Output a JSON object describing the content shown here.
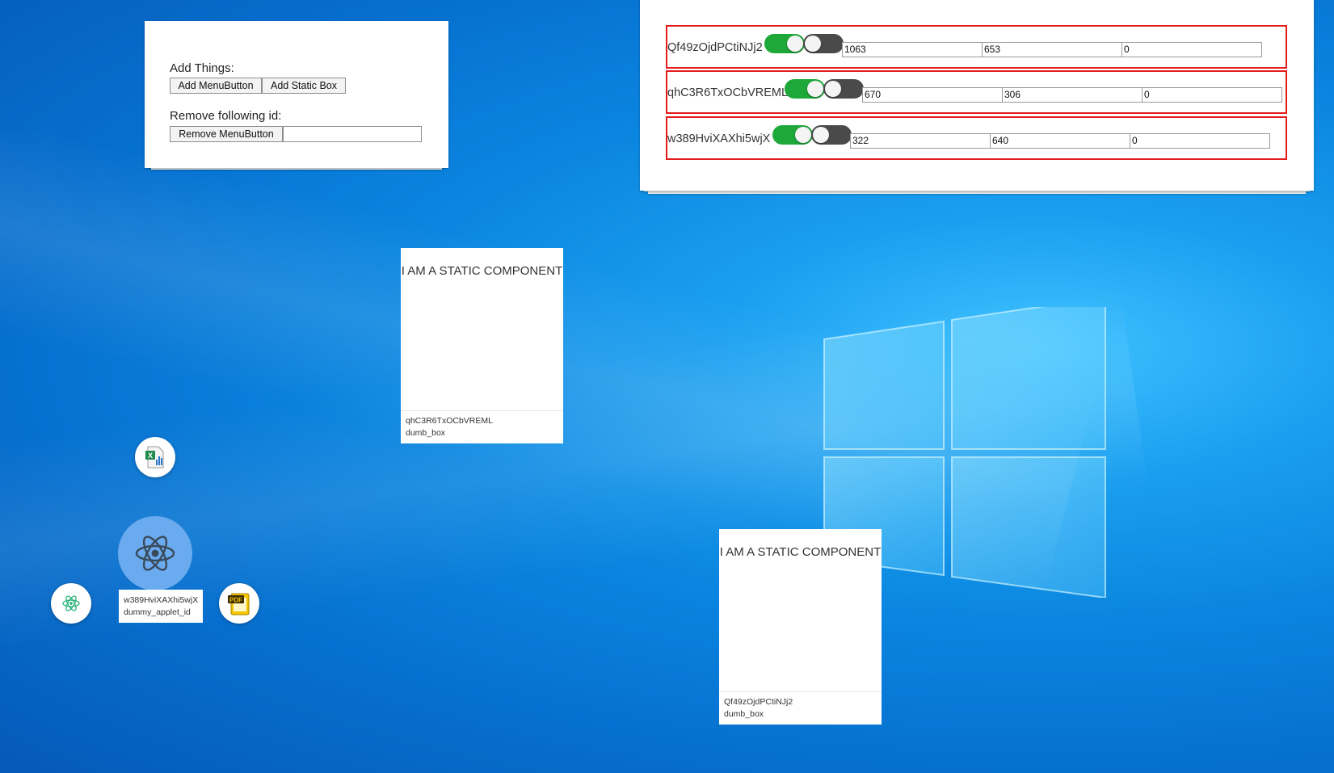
{
  "controls": {
    "add_label": "Add Things:",
    "add_menubutton": "Add MenuButton",
    "add_staticbox": "Add Static Box",
    "remove_label": "Remove following id:",
    "remove_menubutton": "Remove MenuButton",
    "remove_id_value": ""
  },
  "applets": [
    {
      "id": "Qf49zOjdPCtiNJj2",
      "toggle1": "on",
      "toggle2": "off",
      "values": [
        "1063",
        "653",
        "0"
      ]
    },
    {
      "id": "qhC3R6TxOCbVREML",
      "toggle1": "on",
      "toggle2": "off",
      "values": [
        "670",
        "306",
        "0"
      ]
    },
    {
      "id": "w389HviXAXhi5wjX",
      "toggle1": "on",
      "toggle2": "off",
      "values": [
        "322",
        "640",
        "0"
      ]
    }
  ],
  "static_boxes": [
    {
      "text": "I AM A STATIC COMPONENT",
      "id": "qhC3R6TxOCbVREML",
      "type": "dumb_box"
    },
    {
      "text": "I AM A STATIC COMPONENT",
      "id": "Qf49zOjdPCtiNJj2",
      "type": "dumb_box"
    }
  ],
  "menu_button": {
    "id": "w389HviXAXhi5wjX",
    "type": "dummy_applet_id",
    "items": [
      "spreadsheet-app-icon",
      "react-app-icon",
      "pdf-app-icon"
    ],
    "main_icon": "react-icon"
  },
  "colors": {
    "toggle_on": "#1ea83a",
    "toggle_off": "#4a4a4a",
    "row_border": "#e31c1c",
    "menu_button_bg": "#6aabef"
  }
}
